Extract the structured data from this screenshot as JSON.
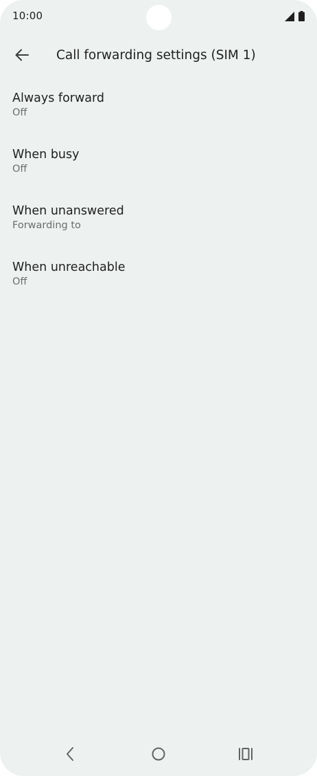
{
  "status_bar": {
    "time": "10:00",
    "icons": [
      "signal-icon",
      "battery-icon"
    ]
  },
  "header": {
    "title": "Call forwarding settings (SIM 1)",
    "back_icon": "arrow-back-icon"
  },
  "settings": [
    {
      "title": "Always forward",
      "summary": "Off"
    },
    {
      "title": "When busy",
      "summary": "Off"
    },
    {
      "title": "When unanswered",
      "summary": "Forwarding to"
    },
    {
      "title": "When unreachable",
      "summary": "Off"
    }
  ],
  "nav_bar": {
    "buttons": [
      "back-nav-icon",
      "home-nav-icon",
      "recents-nav-icon"
    ]
  },
  "colors": {
    "background": "#edf1ef",
    "text_primary": "#1f1f1f",
    "text_secondary": "#6a6f6d"
  }
}
